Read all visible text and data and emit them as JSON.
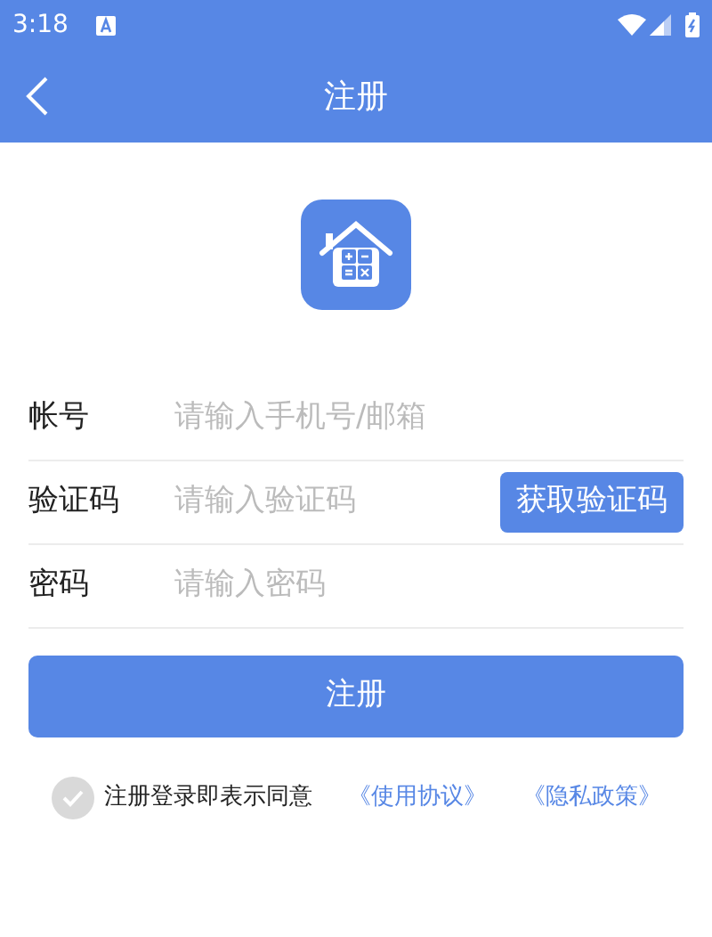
{
  "status_bar": {
    "time": "3:18"
  },
  "header": {
    "title": "注册"
  },
  "fields": [
    {
      "label": "帐号",
      "placeholder": "请输入手机号/邮箱",
      "kind": "text"
    },
    {
      "label": "验证码",
      "placeholder": "请输入验证码",
      "kind": "code",
      "action": "获取验证码"
    },
    {
      "label": "密码",
      "placeholder": "请输入密码",
      "kind": "password"
    }
  ],
  "submit": "注册",
  "agreement": {
    "checked": false,
    "text": "注册登录即表示同意",
    "links": [
      "《使用协议》",
      "《隐私政策》"
    ]
  }
}
